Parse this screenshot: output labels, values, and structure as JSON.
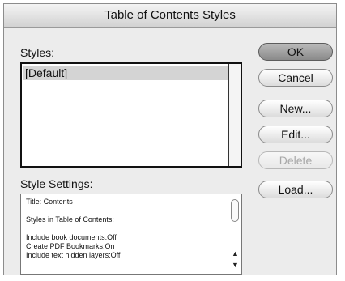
{
  "window": {
    "title": "Table of Contents Styles"
  },
  "styles_section": {
    "label": "Styles:",
    "items": [
      "[Default]"
    ]
  },
  "buttons": {
    "ok": "OK",
    "cancel": "Cancel",
    "new": "New...",
    "edit": "Edit...",
    "delete": "Delete",
    "load": "Load..."
  },
  "settings_section": {
    "label": "Style Settings:",
    "lines": [
      "Title: Contents",
      "",
      "Styles in Table of Contents:",
      "",
      "Include book documents:Off",
      "Create PDF Bookmarks:On",
      "Include text hidden layers:Off"
    ]
  }
}
